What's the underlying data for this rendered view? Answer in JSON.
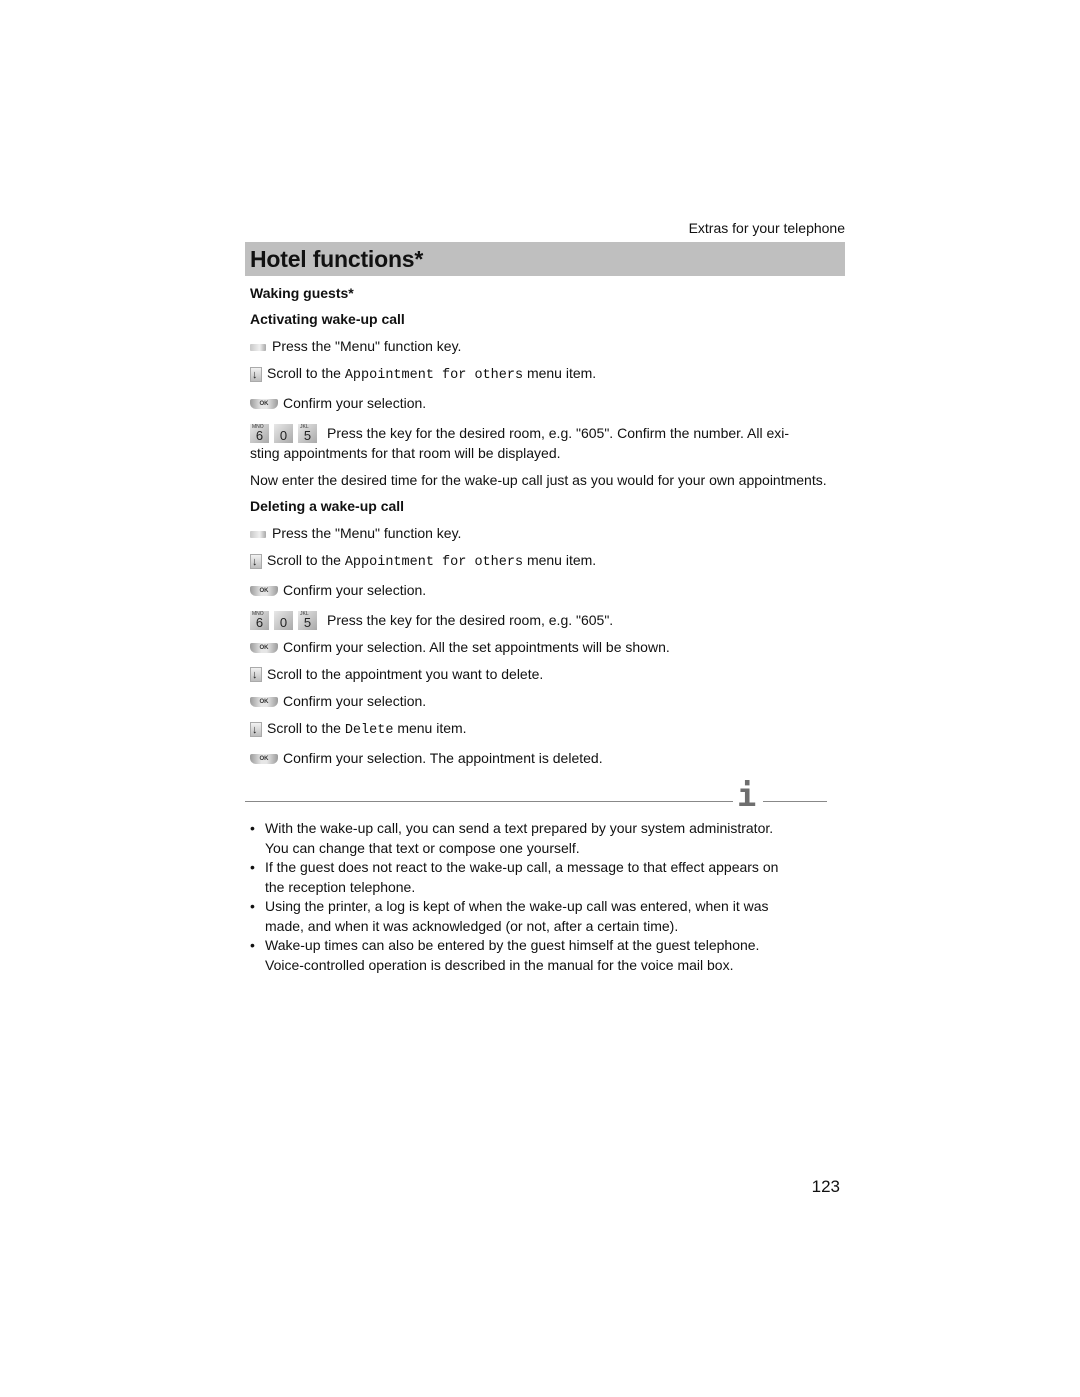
{
  "header": {
    "running_title": "Extras for your telephone",
    "section_title": "Hotel functions*"
  },
  "waking": {
    "heading": "Waking guests*",
    "activating": {
      "heading": "Activating wake-up call",
      "steps": [
        {
          "icon": "menu-function-key-icon",
          "text": "Press the \"Menu\" function key."
        },
        {
          "icon": "scroll-down-icon",
          "pre": "Scroll to the ",
          "mono": "Appointment for others",
          "post": " menu item."
        },
        {
          "icon": "ok-key-icon",
          "icon_label": "OK",
          "text": "Confirm your selection."
        },
        {
          "icon": "digit-keys-icon",
          "keys": [
            {
              "digit": "6",
              "letters": "MNO"
            },
            {
              "digit": "0",
              "letters": ""
            },
            {
              "digit": "5",
              "letters": "JKL"
            }
          ],
          "line1": "Press the key for the desired room, e.g. \"605\". Confirm the number. All exi-",
          "line2": "sting appointments for that room will be displayed."
        }
      ],
      "note": "Now enter the desired time for the wake-up call just as you would for your own appointments."
    },
    "deleting": {
      "heading": "Deleting a wake-up call",
      "steps": [
        {
          "icon": "menu-function-key-icon",
          "text": "Press the \"Menu\" function key."
        },
        {
          "icon": "scroll-down-icon",
          "pre": "Scroll to the ",
          "mono": "Appointment for others",
          "post": " menu item."
        },
        {
          "icon": "ok-key-icon",
          "icon_label": "OK",
          "text": "Confirm your selection."
        },
        {
          "icon": "digit-keys-icon",
          "keys": [
            {
              "digit": "6",
              "letters": "MNO"
            },
            {
              "digit": "0",
              "letters": ""
            },
            {
              "digit": "5",
              "letters": "JKL"
            }
          ],
          "text": "Press the key for the desired room, e.g. \"605\"."
        },
        {
          "icon": "ok-key-icon",
          "icon_label": "OK",
          "text": "Confirm your selection. All the set appointments will be shown."
        },
        {
          "icon": "scroll-down-icon",
          "text": "Scroll to the appointment you want to delete."
        },
        {
          "icon": "ok-key-icon",
          "icon_label": "OK",
          "text": "Confirm your selection."
        },
        {
          "icon": "scroll-down-icon",
          "pre": "Scroll to the ",
          "mono": "Delete",
          "post": " menu item."
        },
        {
          "icon": "ok-key-icon",
          "icon_label": "OK",
          "text": "Confirm your selection. The appointment is deleted."
        }
      ]
    }
  },
  "info": {
    "icon": "info-icon",
    "glyph": "i",
    "notes": [
      {
        "line1": "With the wake-up call, you can send a text prepared by your system administrator.",
        "line2": "You can change that text or compose one yourself."
      },
      {
        "line1": "If the guest does not react to the wake-up call, a message to that effect appears on",
        "line2": "the reception telephone."
      },
      {
        "line1": "Using the printer, a log is kept of when the wake-up call was entered, when it was",
        "line2": "made, and when it was acknowledged (or not, after a certain time)."
      },
      {
        "line1": "Wake-up times can also be entered by the guest himself at the guest telephone.",
        "line2": "Voice-controlled operation is described in the manual for the voice mail box."
      }
    ]
  },
  "footer": {
    "page_number": "123"
  }
}
